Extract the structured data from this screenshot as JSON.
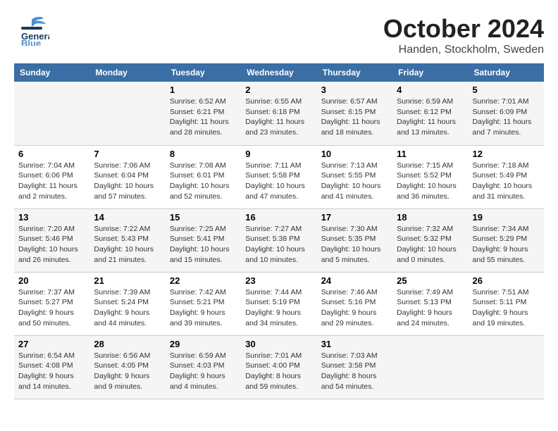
{
  "header": {
    "logo_general": "General",
    "logo_blue": "Blue",
    "month": "October 2024",
    "location": "Handen, Stockholm, Sweden"
  },
  "columns": [
    "Sunday",
    "Monday",
    "Tuesday",
    "Wednesday",
    "Thursday",
    "Friday",
    "Saturday"
  ],
  "weeks": [
    [
      {
        "day": "",
        "sunrise": "",
        "sunset": "",
        "daylight": ""
      },
      {
        "day": "",
        "sunrise": "",
        "sunset": "",
        "daylight": ""
      },
      {
        "day": "1",
        "sunrise": "Sunrise: 6:52 AM",
        "sunset": "Sunset: 6:21 PM",
        "daylight": "Daylight: 11 hours and 28 minutes."
      },
      {
        "day": "2",
        "sunrise": "Sunrise: 6:55 AM",
        "sunset": "Sunset: 6:18 PM",
        "daylight": "Daylight: 11 hours and 23 minutes."
      },
      {
        "day": "3",
        "sunrise": "Sunrise: 6:57 AM",
        "sunset": "Sunset: 6:15 PM",
        "daylight": "Daylight: 11 hours and 18 minutes."
      },
      {
        "day": "4",
        "sunrise": "Sunrise: 6:59 AM",
        "sunset": "Sunset: 6:12 PM",
        "daylight": "Daylight: 11 hours and 13 minutes."
      },
      {
        "day": "5",
        "sunrise": "Sunrise: 7:01 AM",
        "sunset": "Sunset: 6:09 PM",
        "daylight": "Daylight: 11 hours and 7 minutes."
      }
    ],
    [
      {
        "day": "6",
        "sunrise": "Sunrise: 7:04 AM",
        "sunset": "Sunset: 6:06 PM",
        "daylight": "Daylight: 11 hours and 2 minutes."
      },
      {
        "day": "7",
        "sunrise": "Sunrise: 7:06 AM",
        "sunset": "Sunset: 6:04 PM",
        "daylight": "Daylight: 10 hours and 57 minutes."
      },
      {
        "day": "8",
        "sunrise": "Sunrise: 7:08 AM",
        "sunset": "Sunset: 6:01 PM",
        "daylight": "Daylight: 10 hours and 52 minutes."
      },
      {
        "day": "9",
        "sunrise": "Sunrise: 7:11 AM",
        "sunset": "Sunset: 5:58 PM",
        "daylight": "Daylight: 10 hours and 47 minutes."
      },
      {
        "day": "10",
        "sunrise": "Sunrise: 7:13 AM",
        "sunset": "Sunset: 5:55 PM",
        "daylight": "Daylight: 10 hours and 41 minutes."
      },
      {
        "day": "11",
        "sunrise": "Sunrise: 7:15 AM",
        "sunset": "Sunset: 5:52 PM",
        "daylight": "Daylight: 10 hours and 36 minutes."
      },
      {
        "day": "12",
        "sunrise": "Sunrise: 7:18 AM",
        "sunset": "Sunset: 5:49 PM",
        "daylight": "Daylight: 10 hours and 31 minutes."
      }
    ],
    [
      {
        "day": "13",
        "sunrise": "Sunrise: 7:20 AM",
        "sunset": "Sunset: 5:46 PM",
        "daylight": "Daylight: 10 hours and 26 minutes."
      },
      {
        "day": "14",
        "sunrise": "Sunrise: 7:22 AM",
        "sunset": "Sunset: 5:43 PM",
        "daylight": "Daylight: 10 hours and 21 minutes."
      },
      {
        "day": "15",
        "sunrise": "Sunrise: 7:25 AM",
        "sunset": "Sunset: 5:41 PM",
        "daylight": "Daylight: 10 hours and 15 minutes."
      },
      {
        "day": "16",
        "sunrise": "Sunrise: 7:27 AM",
        "sunset": "Sunset: 5:38 PM",
        "daylight": "Daylight: 10 hours and 10 minutes."
      },
      {
        "day": "17",
        "sunrise": "Sunrise: 7:30 AM",
        "sunset": "Sunset: 5:35 PM",
        "daylight": "Daylight: 10 hours and 5 minutes."
      },
      {
        "day": "18",
        "sunrise": "Sunrise: 7:32 AM",
        "sunset": "Sunset: 5:32 PM",
        "daylight": "Daylight: 10 hours and 0 minutes."
      },
      {
        "day": "19",
        "sunrise": "Sunrise: 7:34 AM",
        "sunset": "Sunset: 5:29 PM",
        "daylight": "Daylight: 9 hours and 55 minutes."
      }
    ],
    [
      {
        "day": "20",
        "sunrise": "Sunrise: 7:37 AM",
        "sunset": "Sunset: 5:27 PM",
        "daylight": "Daylight: 9 hours and 50 minutes."
      },
      {
        "day": "21",
        "sunrise": "Sunrise: 7:39 AM",
        "sunset": "Sunset: 5:24 PM",
        "daylight": "Daylight: 9 hours and 44 minutes."
      },
      {
        "day": "22",
        "sunrise": "Sunrise: 7:42 AM",
        "sunset": "Sunset: 5:21 PM",
        "daylight": "Daylight: 9 hours and 39 minutes."
      },
      {
        "day": "23",
        "sunrise": "Sunrise: 7:44 AM",
        "sunset": "Sunset: 5:19 PM",
        "daylight": "Daylight: 9 hours and 34 minutes."
      },
      {
        "day": "24",
        "sunrise": "Sunrise: 7:46 AM",
        "sunset": "Sunset: 5:16 PM",
        "daylight": "Daylight: 9 hours and 29 minutes."
      },
      {
        "day": "25",
        "sunrise": "Sunrise: 7:49 AM",
        "sunset": "Sunset: 5:13 PM",
        "daylight": "Daylight: 9 hours and 24 minutes."
      },
      {
        "day": "26",
        "sunrise": "Sunrise: 7:51 AM",
        "sunset": "Sunset: 5:11 PM",
        "daylight": "Daylight: 9 hours and 19 minutes."
      }
    ],
    [
      {
        "day": "27",
        "sunrise": "Sunrise: 6:54 AM",
        "sunset": "Sunset: 4:08 PM",
        "daylight": "Daylight: 9 hours and 14 minutes."
      },
      {
        "day": "28",
        "sunrise": "Sunrise: 6:56 AM",
        "sunset": "Sunset: 4:05 PM",
        "daylight": "Daylight: 9 hours and 9 minutes."
      },
      {
        "day": "29",
        "sunrise": "Sunrise: 6:59 AM",
        "sunset": "Sunset: 4:03 PM",
        "daylight": "Daylight: 9 hours and 4 minutes."
      },
      {
        "day": "30",
        "sunrise": "Sunrise: 7:01 AM",
        "sunset": "Sunset: 4:00 PM",
        "daylight": "Daylight: 8 hours and 59 minutes."
      },
      {
        "day": "31",
        "sunrise": "Sunrise: 7:03 AM",
        "sunset": "Sunset: 3:58 PM",
        "daylight": "Daylight: 8 hours and 54 minutes."
      },
      {
        "day": "",
        "sunrise": "",
        "sunset": "",
        "daylight": ""
      },
      {
        "day": "",
        "sunrise": "",
        "sunset": "",
        "daylight": ""
      }
    ]
  ]
}
